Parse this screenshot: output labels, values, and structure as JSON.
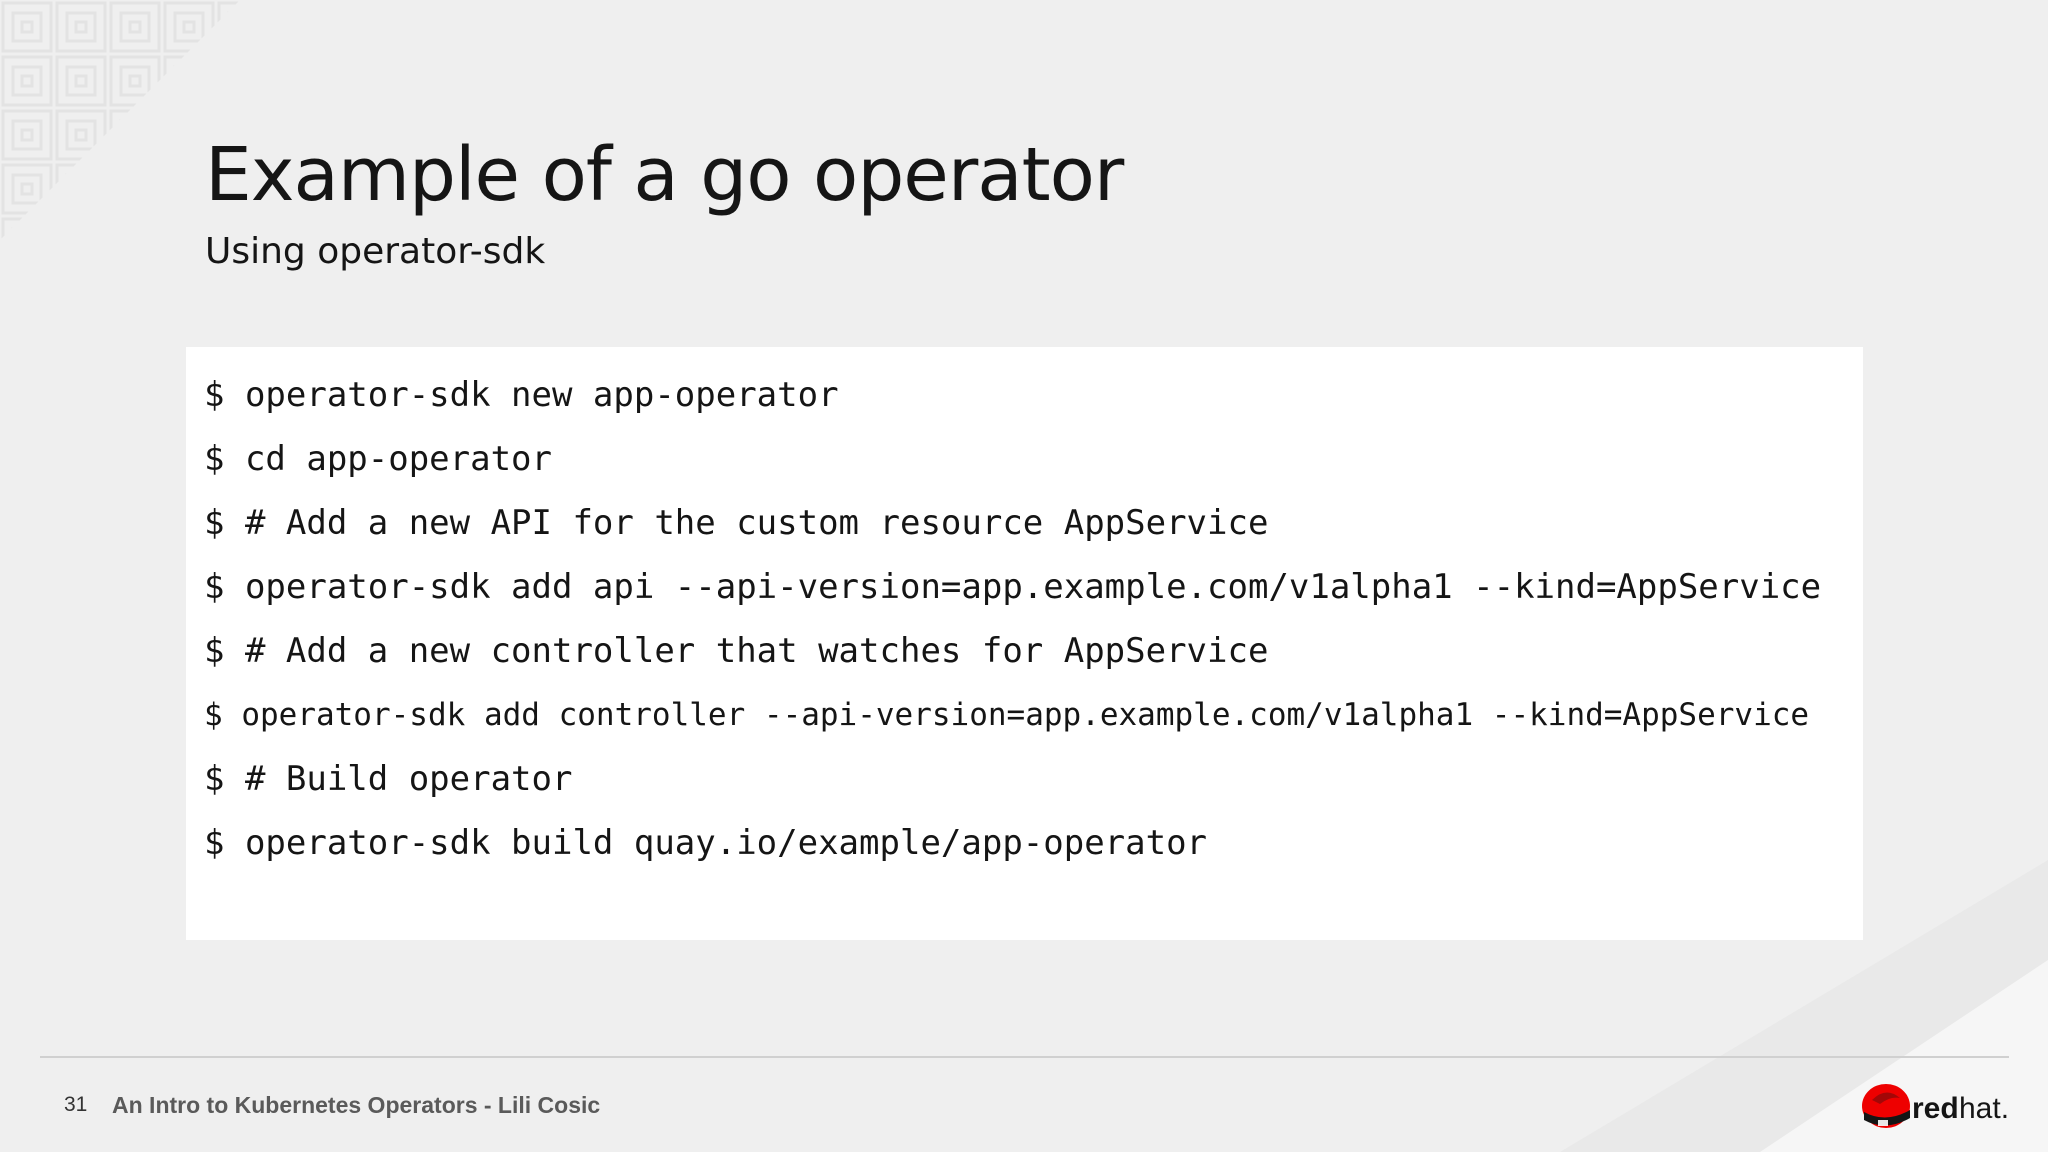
{
  "slide": {
    "title": "Example of a go operator",
    "subtitle": "Using operator-sdk"
  },
  "code": {
    "lines": [
      "$ operator-sdk new app-operator",
      "$ cd app-operator",
      "$ # Add a new API for the custom resource AppService",
      "$ operator-sdk add api --api-version=app.example.com/v1alpha1 --kind=AppService",
      "$ # Add a new controller that watches for AppService",
      "$ operator-sdk add controller --api-version=app.example.com/v1alpha1 --kind=AppService",
      "$ # Build operator",
      "$ operator-sdk build quay.io/example/app-operator"
    ]
  },
  "footer": {
    "page_number": "31",
    "text": "An Intro to Kubernetes Operators - Lili Cosic"
  },
  "logo": {
    "wordmark_bold": "red",
    "wordmark_light": "hat.",
    "brand_color": "#ee0000"
  },
  "colors": {
    "background": "#efefef",
    "code_background": "#ffffff",
    "text": "#151515"
  }
}
